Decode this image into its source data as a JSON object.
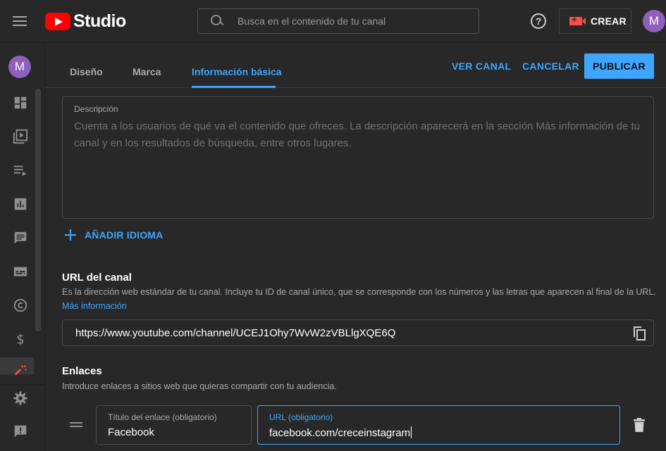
{
  "header": {
    "logo_text": "Studio",
    "search_placeholder": "Busca en el contenido de tu canal",
    "help_glyph": "?",
    "create_label": "CREAR",
    "avatar_initial": "M"
  },
  "sidebar": {
    "avatar_initial": "M",
    "items": [
      {
        "icon": "dashboard-icon"
      },
      {
        "icon": "content-icon"
      },
      {
        "icon": "playlists-icon"
      },
      {
        "icon": "analytics-icon"
      },
      {
        "icon": "comments-icon"
      },
      {
        "icon": "subtitles-icon"
      },
      {
        "icon": "copyright-icon"
      },
      {
        "icon": "monetization-icon"
      },
      {
        "icon": "customization-icon"
      },
      {
        "icon": "settings-icon"
      },
      {
        "icon": "feedback-icon"
      }
    ]
  },
  "tabs": [
    {
      "label": "Diseño",
      "active": false
    },
    {
      "label": "Marca",
      "active": false
    },
    {
      "label": "Información básica",
      "active": true
    }
  ],
  "actions": {
    "view_channel": "VER CANAL",
    "cancel": "CANCELAR",
    "publish": "PUBLICAR"
  },
  "description": {
    "label": "Descripción",
    "placeholder": "Cuenta a los usuarios de qué va el contenido que ofreces. La descripción aparecerá en la sección Más información de tu canal y en los resultados de búsqueda, entre otros lugares."
  },
  "add_language": "AÑADIR IDIOMA",
  "channel_url": {
    "title": "URL del canal",
    "description": "Es la dirección web estándar de tu canal. Incluye tu ID de canal único, que se corresponde con los números y las letras que aparecen al final de la URL.",
    "more_info": "Más información",
    "value": "https://www.youtube.com/channel/UCEJ1Ohy7WvW2zVBLlgXQE6Q"
  },
  "links": {
    "title": "Enlaces",
    "description": "Introduce enlaces a sitios web que quieras compartir con tu audiencia.",
    "items": [
      {
        "title_label": "Título del enlace (obligatorio)",
        "title_value": "Facebook",
        "url_label": "URL (obligatorio)",
        "url_value": "facebook.com/creceinstagram"
      }
    ]
  },
  "colors": {
    "accent": "#3ea6ff",
    "background": "#282828",
    "brand_red": "#ff0000",
    "avatar": "#8e5fbd"
  }
}
